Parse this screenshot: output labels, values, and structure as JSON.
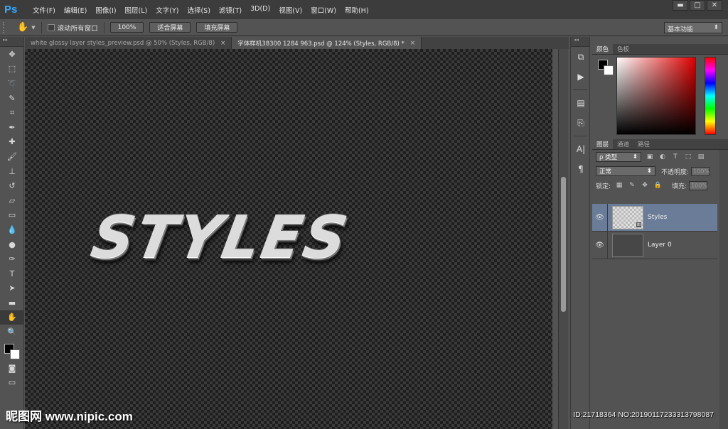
{
  "app": {
    "logo": "Ps"
  },
  "menu": [
    "文件(F)",
    "编辑(E)",
    "图像(I)",
    "图层(L)",
    "文字(Y)",
    "选择(S)",
    "滤镜(T)",
    "3D(D)",
    "视图(V)",
    "窗口(W)",
    "帮助(H)"
  ],
  "window_controls": {
    "minimize": "▬",
    "restore": "□",
    "close": "✕"
  },
  "options": {
    "tool_icon": "hand-icon",
    "tool_glyph": "✋",
    "scroll_all_label": "滚动所有窗口",
    "btn_100": "100%",
    "btn_fit": "适合屏幕",
    "btn_fill": "填充屏幕",
    "workspace": "基本功能"
  },
  "tabs": [
    {
      "label": "white glossy layer styles_preview.psd @ 50% (Styles, RGB/8)",
      "active": false
    },
    {
      "label": "字体样机38300 1284 963.psd @ 124% (Styles, RGB/8) *",
      "active": true
    }
  ],
  "tab_close": "×",
  "canvas": {
    "text": "STYLES"
  },
  "tools": [
    {
      "name": "move-tool-icon",
      "glyph": "✥"
    },
    {
      "name": "marquee-tool-icon",
      "glyph": "⬚"
    },
    {
      "name": "lasso-tool-icon",
      "glyph": "➰"
    },
    {
      "name": "quick-select-tool-icon",
      "glyph": "✎"
    },
    {
      "name": "crop-tool-icon",
      "glyph": "⌗"
    },
    {
      "name": "eyedropper-tool-icon",
      "glyph": "✒"
    },
    {
      "name": "healing-brush-tool-icon",
      "glyph": "✚"
    },
    {
      "name": "brush-tool-icon",
      "glyph": "🖌"
    },
    {
      "name": "clone-stamp-tool-icon",
      "glyph": "⊥"
    },
    {
      "name": "history-brush-tool-icon",
      "glyph": "↺"
    },
    {
      "name": "eraser-tool-icon",
      "glyph": "▱"
    },
    {
      "name": "gradient-tool-icon",
      "glyph": "▭"
    },
    {
      "name": "blur-tool-icon",
      "glyph": "💧"
    },
    {
      "name": "dodge-tool-icon",
      "glyph": "●"
    },
    {
      "name": "pen-tool-icon",
      "glyph": "✑"
    },
    {
      "name": "type-tool-icon",
      "glyph": "T"
    },
    {
      "name": "path-select-tool-icon",
      "glyph": "➤"
    },
    {
      "name": "rectangle-tool-icon",
      "glyph": "▬"
    },
    {
      "name": "hand-tool-icon",
      "glyph": "✋",
      "active": true
    },
    {
      "name": "zoom-tool-icon",
      "glyph": "🔍"
    }
  ],
  "panels": {
    "color_tabs": [
      "颜色",
      "色板"
    ],
    "layers_tabs": [
      "图层",
      "通道",
      "路径"
    ],
    "filter_label": "ρ 类型",
    "blend_mode": "正常",
    "opacity_label": "不透明度:",
    "opacity_value": "100%",
    "lock_label": "锁定:",
    "fill_label": "填充:",
    "fill_value": "100%"
  },
  "layers": [
    {
      "name": "Styles",
      "selected": true,
      "thumb": "checker",
      "fx": "⊞"
    },
    {
      "name": "Layer 0",
      "selected": false,
      "thumb": "dark"
    }
  ],
  "layer_eye": "👁",
  "dock_icons": [
    {
      "name": "history-panel-icon",
      "glyph": "⧉"
    },
    {
      "name": "actions-play-icon",
      "glyph": "▶"
    },
    {
      "name": "adjustments-icon",
      "glyph": "▤"
    },
    {
      "name": "clone-source-icon",
      "glyph": "⎘"
    },
    {
      "name": "character-panel-icon",
      "glyph": "A|"
    },
    {
      "name": "paragraph-panel-icon",
      "glyph": "¶"
    }
  ],
  "watermark": "昵图网 www.nipic.com",
  "id_mark": "ID:21718364 NO:20190117233313798087",
  "colors": {
    "ps_blue": "#31a8ff",
    "selected_layer": "#6a7c97",
    "panel_bg": "#535353",
    "menubar_bg": "#3c3c3c"
  }
}
